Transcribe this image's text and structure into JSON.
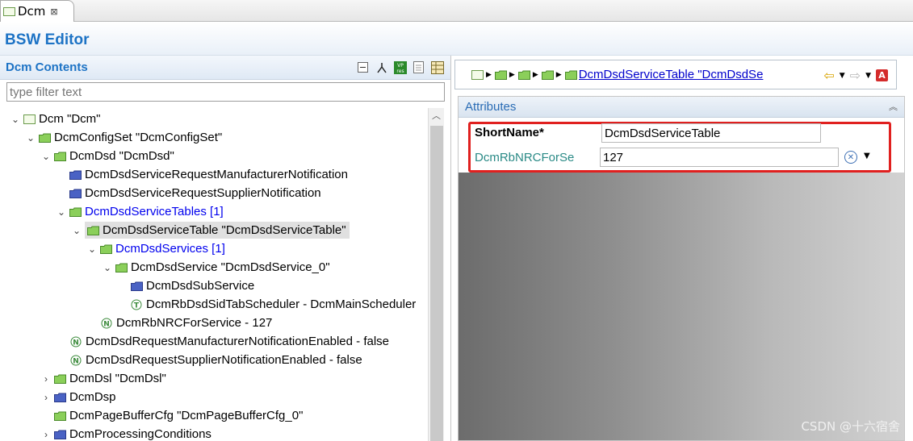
{
  "tab": {
    "label": "Dcm",
    "close": "⊠"
  },
  "editor": {
    "title": "BSW Editor"
  },
  "left": {
    "title": "Dcm Contents",
    "filter_placeholder": "type filter text",
    "tree": [
      {
        "label": "Dcm \"Dcm\"",
        "expanded": true,
        "icon": "module-icon"
      },
      {
        "label": "DcmConfigSet \"DcmConfigSet\"",
        "expanded": true,
        "icon": "green-folder-icon"
      },
      {
        "label": "DcmDsd \"DcmDsd\"",
        "expanded": true,
        "icon": "green-folder-icon"
      },
      {
        "label": "DcmDsdServiceRequestManufacturerNotification",
        "icon": "blue-folder-icon"
      },
      {
        "label": "DcmDsdServiceRequestSupplierNotification",
        "icon": "blue-folder-icon"
      },
      {
        "label": "DcmDsdServiceTables [1]",
        "expanded": true,
        "icon": "green-folder-icon",
        "link": true
      },
      {
        "label": "DcmDsdServiceTable \"DcmDsdServiceTable\"",
        "expanded": true,
        "icon": "green-folder-icon",
        "selected": true
      },
      {
        "label": "DcmDsdServices [1]",
        "expanded": true,
        "icon": "green-folder-icon",
        "link": true
      },
      {
        "label": "DcmDsdService \"DcmDsdService_0\"",
        "expanded": true,
        "icon": "green-folder-icon"
      },
      {
        "label": "DcmDsdSubService",
        "icon": "blue-folder-icon"
      },
      {
        "label": "DcmRbDsdSidTabScheduler - DcmMainScheduler",
        "icon": "text-param-icon",
        "glyph": "T"
      },
      {
        "label": "DcmRbNRCForService - 127",
        "icon": "numeric-param-icon",
        "glyph": "N"
      },
      {
        "label": "DcmDsdRequestManufacturerNotificationEnabled - false",
        "icon": "numeric-param-icon",
        "glyph": "N"
      },
      {
        "label": "DcmDsdRequestSupplierNotificationEnabled - false",
        "icon": "numeric-param-icon",
        "glyph": "N"
      },
      {
        "label": "DcmDsl \"DcmDsl\"",
        "expanded": false,
        "icon": "green-folder-icon"
      },
      {
        "label": "DcmDsp",
        "expanded": false,
        "icon": "blue-folder-icon"
      },
      {
        "label": "DcmPageBufferCfg \"DcmPageBufferCfg_0\"",
        "icon": "green-folder-icon"
      },
      {
        "label": "DcmProcessingConditions",
        "expanded": false,
        "icon": "blue-folder-icon"
      }
    ]
  },
  "breadcrumb": {
    "link": "DcmDsdServiceTable \"DcmDsdSe"
  },
  "attributes": {
    "title": "Attributes",
    "shortname_label": "ShortName*",
    "shortname_value": "DcmDsdServiceTable",
    "nrc_label": "DcmRbNRCForSe",
    "nrc_value": "127"
  },
  "watermark": "CSDN @十六宿舍"
}
